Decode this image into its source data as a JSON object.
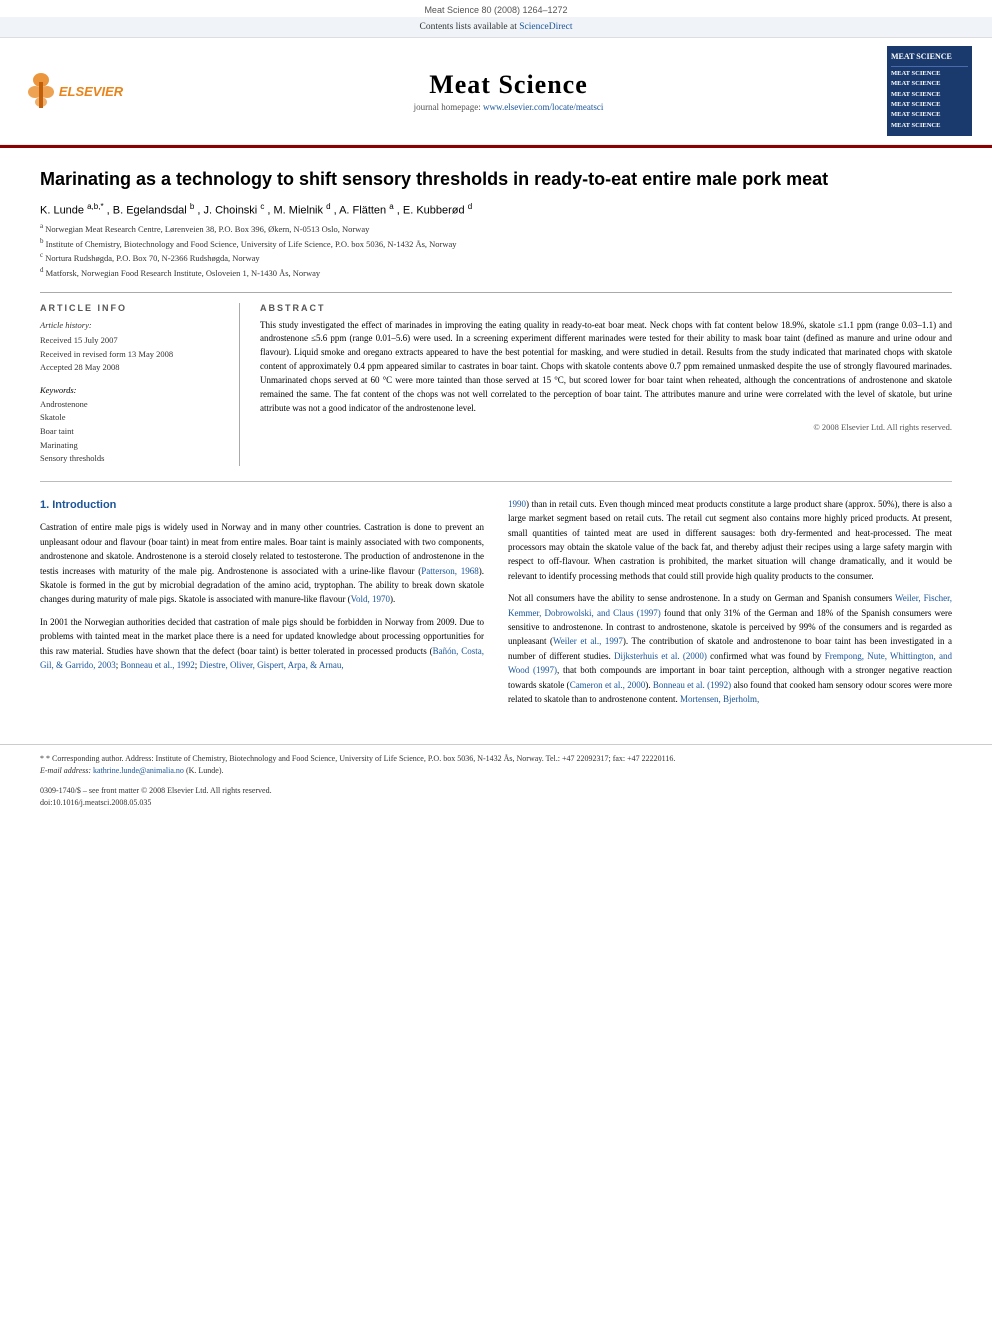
{
  "journal": {
    "meta_top": "Meat Science 80 (2008) 1264–1272",
    "contents_label": "Contents lists available at",
    "sciencedirect": "ScienceDirect",
    "name": "Meat Science",
    "homepage_label": "journal homepage:",
    "homepage_url": "www.elsevier.com/locate/meatsci",
    "logo_lines": [
      "MEAT SCIENCE",
      "MEAT SCIENCE",
      "MEAT SCIENCE",
      "MEAT SCIENCE",
      "MEAT SCIENCE",
      "MEAT SCIENCE",
      "MEAT SCIENCE"
    ]
  },
  "article": {
    "title": "Marinating as a technology to shift sensory thresholds in ready-to-eat entire male pork meat",
    "authors_text": "K. Lunde a,b,*, B. Egelandsdal b, J. Choinski c, M. Mielnik d, A. Flätten a, E. Kubberød d",
    "affiliations": [
      "a Norwegian Meat Research Centre, Lørenveien 38, P.O. Box 396, Økern, N-0513 Oslo, Norway",
      "b Institute of Chemistry, Biotechnology and Food Science, University of Life Science, P.O. box 5036, N-1432 Ås, Norway",
      "c Nortura Rudshøgda, P.O. Box 70, N-2366 Rudshøgda, Norway",
      "d Matforsk, Norwegian Food Research Institute, Osloveien 1, N-1430 Ås, Norway"
    ],
    "article_info_label": "ARTICLE INFO",
    "abstract_label": "ABSTRACT",
    "history_label": "Article history:",
    "received": "Received 15 July 2007",
    "received_revised": "Received in revised form 13 May 2008",
    "accepted": "Accepted 28 May 2008",
    "keywords_label": "Keywords:",
    "keywords": [
      "Androstenone",
      "Skatole",
      "Boar taint",
      "Marinating",
      "Sensory thresholds"
    ],
    "abstract": "This study investigated the effect of marinades in improving the eating quality in ready-to-eat boar meat. Neck chops with fat content below 18.9%, skatole ≤1.1 ppm (range 0.03–1.1) and androstenone ≤5.6 ppm (range 0.01–5.6) were used. In a screening experiment different marinades were tested for their ability to mask boar taint (defined as manure and urine odour and flavour). Liquid smoke and oregano extracts appeared to have the best potential for masking, and were studied in detail. Results from the study indicated that marinated chops with skatole content of approximately 0.4 ppm appeared similar to castrates in boar taint. Chops with skatole contents above 0.7 ppm remained unmasked despite the use of strongly flavoured marinades. Unmarinated chops served at 60 °C were more tainted than those served at 15 °C, but scored lower for boar taint when reheated, although the concentrations of androstenone and skatole remained the same. The fat content of the chops was not well correlated to the perception of boar taint. The attributes manure and urine were correlated with the level of skatole, but urine attribute was not a good indicator of the androstenone level.",
    "copyright": "© 2008 Elsevier Ltd. All rights reserved.",
    "intro_section": "1. Introduction",
    "intro_col1_para1": "Castration of entire male pigs is widely used in Norway and in many other countries. Castration is done to prevent an unpleasant odour and flavour (boar taint) in meat from entire males. Boar taint is mainly associated with two components, androstenone and skatole. Androstenone is a steroid closely related to testosterone. The production of androstenone in the testis increases with maturity of the male pig. Androstenone is associated with a urine-like flavour (Patterson, 1968). Skatole is formed in the gut by microbial degradation of the amino acid, tryptophan. The ability to break down skatole changes during maturity of male pigs. Skatole is associated with manure-like flavour (Vold, 1970).",
    "intro_col1_para2": "In 2001 the Norwegian authorities decided that castration of male pigs should be forbidden in Norway from 2009. Due to problems with tainted meat in the market place there is a need for updated knowledge about processing opportunities for this raw material. Studies have shown that the defect (boar taint) is better tolerated in processed products (Bañón, Costa, Gil, & Garrido, 2003; Bonneau et al., 1992; Diestre, Oliver, Gispert, Arpa, & Arnau,",
    "intro_col2_para1": "1990) than in retail cuts. Even though minced meat products constitute a large product share (approx. 50%), there is also a large market segment based on retail cuts. The retail cut segment also contains more highly priced products. At present, small quantities of tainted meat are used in different sausages: both dry-fermented and heat-processed. The meat processors may obtain the skatole value of the back fat, and thereby adjust their recipes using a large safety margin with respect to off-flavour. When castration is prohibited, the market situation will change dramatically, and it would be relevant to identify processing methods that could still provide high quality products to the consumer.",
    "intro_col2_para2": "Not all consumers have the ability to sense androstenone. In a study on German and Spanish consumers Weiler, Fischer, Kemmer, Dobrowolski, and Claus (1997) found that only 31% of the German and 18% of the Spanish consumers were sensitive to androstenone. In contrast to androstenone, skatole is perceived by 99% of the consumers and is regarded as unpleasant (Weiler et al., 1997). The contribution of skatole and androstenone to boar taint has been investigated in a number of different studies. Dijksterhuis et al. (2000) confirmed what was found by Frempong, Nute, Whitting-ton, and Wood (1997), that both compounds are important in boar taint perception, although with a stronger negative reaction towards skatole (Cameron et al., 2000). Bonneau et al. (1992) also found that cooked ham sensory odour scores were more related to skatole than to androstenone content. Mortensen, Bjerholm,",
    "footnote_star": "* Corresponding author. Address: Institute of Chemistry, Biotechnology and Food Science, University of Life Science, P.O. box 5036, N-1432 Ås, Norway. Tel.: +47 22092317; fax: +47 22220116.",
    "footnote_email_label": "E-mail address:",
    "footnote_email": "kathrine.lunde@animalia.no",
    "footnote_email_suffix": "(K. Lunde).",
    "issn_line": "0309-1740/$ – see front matter © 2008 Elsevier Ltd. All rights reserved.",
    "doi_line": "doi:10.1016/j.meatsci.2008.05.035"
  }
}
